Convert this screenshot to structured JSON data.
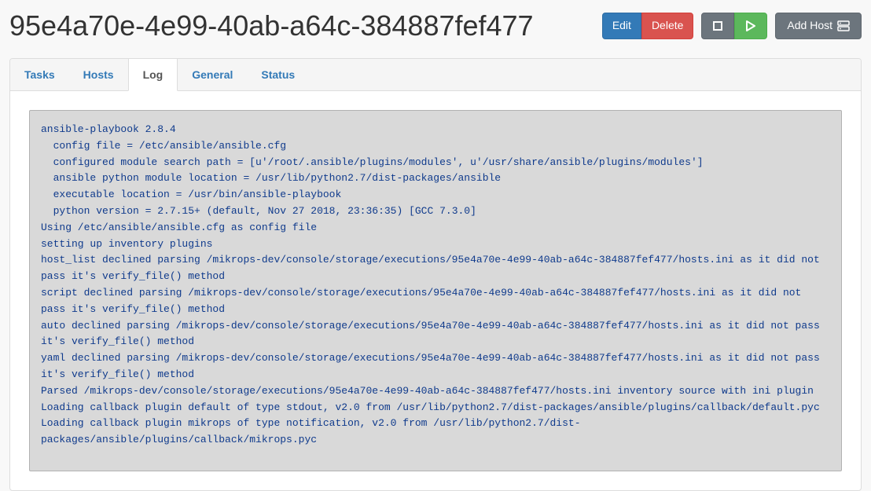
{
  "header": {
    "title": "95e4a70e-4e99-40ab-a64c-384887fef477",
    "buttons": {
      "edit": "Edit",
      "delete": "Delete",
      "add_host": "Add Host"
    }
  },
  "tabs": {
    "items": [
      {
        "label": "Tasks",
        "active": false
      },
      {
        "label": "Hosts",
        "active": false
      },
      {
        "label": "Log",
        "active": true
      },
      {
        "label": "General",
        "active": false
      },
      {
        "label": "Status",
        "active": false
      }
    ]
  },
  "log": {
    "text": "ansible-playbook 2.8.4\n  config file = /etc/ansible/ansible.cfg\n  configured module search path = [u'/root/.ansible/plugins/modules', u'/usr/share/ansible/plugins/modules']\n  ansible python module location = /usr/lib/python2.7/dist-packages/ansible\n  executable location = /usr/bin/ansible-playbook\n  python version = 2.7.15+ (default, Nov 27 2018, 23:36:35) [GCC 7.3.0]\nUsing /etc/ansible/ansible.cfg as config file\nsetting up inventory plugins\nhost_list declined parsing /mikrops-dev/console/storage/executions/95e4a70e-4e99-40ab-a64c-384887fef477/hosts.ini as it did not pass it's verify_file() method\nscript declined parsing /mikrops-dev/console/storage/executions/95e4a70e-4e99-40ab-a64c-384887fef477/hosts.ini as it did not pass it's verify_file() method\nauto declined parsing /mikrops-dev/console/storage/executions/95e4a70e-4e99-40ab-a64c-384887fef477/hosts.ini as it did not pass it's verify_file() method\nyaml declined parsing /mikrops-dev/console/storage/executions/95e4a70e-4e99-40ab-a64c-384887fef477/hosts.ini as it did not pass it's verify_file() method\nParsed /mikrops-dev/console/storage/executions/95e4a70e-4e99-40ab-a64c-384887fef477/hosts.ini inventory source with ini plugin\nLoading callback plugin default of type stdout, v2.0 from /usr/lib/python2.7/dist-packages/ansible/plugins/callback/default.pyc\nLoading callback plugin mikrops of type notification, v2.0 from /usr/lib/python2.7/dist-packages/ansible/plugins/callback/mikrops.pyc"
  }
}
